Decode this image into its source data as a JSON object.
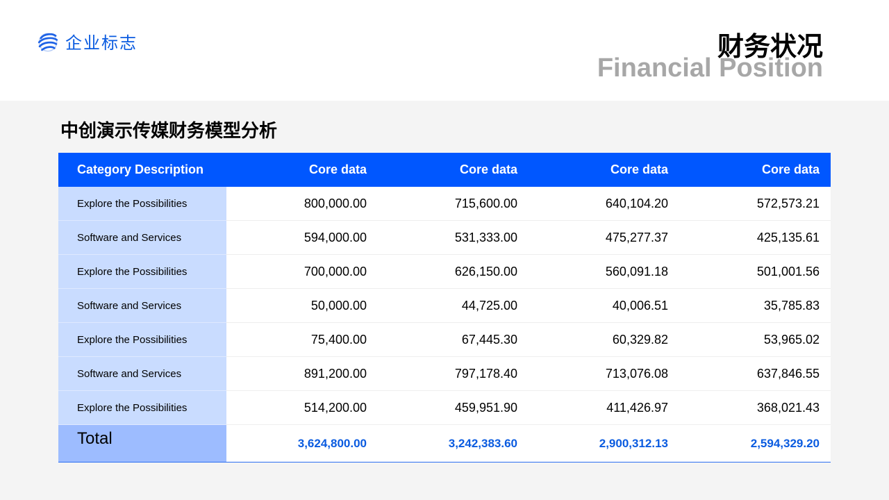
{
  "header": {
    "logo_text": "企业标志",
    "title_cn": "财务状况",
    "title_en": "Financial Position"
  },
  "section": {
    "title": "中创演示传媒财务模型分析"
  },
  "table": {
    "headers": [
      "Category Description",
      "Core data",
      "Core data",
      "Core data",
      "Core data"
    ],
    "rows": [
      {
        "category": "Explore the Possibilities",
        "values": [
          "800,000.00",
          "715,600.00",
          "640,104.20",
          "572,573.21"
        ]
      },
      {
        "category": "Software and Services",
        "values": [
          "594,000.00",
          "531,333.00",
          "475,277.37",
          "425,135.61"
        ]
      },
      {
        "category": "Explore the Possibilities",
        "values": [
          "700,000.00",
          "626,150.00",
          "560,091.18",
          "501,001.56"
        ]
      },
      {
        "category": "Software and Services",
        "values": [
          "50,000.00",
          "44,725.00",
          "40,006.51",
          "35,785.83"
        ]
      },
      {
        "category": "Explore the Possibilities",
        "values": [
          "75,400.00",
          "67,445.30",
          "60,329.82",
          "53,965.02"
        ]
      },
      {
        "category": "Software and Services",
        "values": [
          "891,200.00",
          "797,178.40",
          "713,076.08",
          "637,846.55"
        ]
      },
      {
        "category": "Explore the Possibilities",
        "values": [
          "514,200.00",
          "459,951.90",
          "411,426.97",
          "368,021.43"
        ]
      }
    ],
    "total": {
      "label": "Total",
      "values": [
        "3,624,800.00",
        "3,242,383.60",
        "2,900,312.13",
        "2,594,329.20"
      ]
    }
  },
  "colors": {
    "accent": "#0057ff",
    "category_bg": "#c9dcff",
    "total_label_bg": "#9dbcff",
    "total_text": "#0a5be0",
    "subtitle_gray": "#a7a7a7"
  },
  "icons": {
    "logo": "globe-swirl-icon"
  }
}
